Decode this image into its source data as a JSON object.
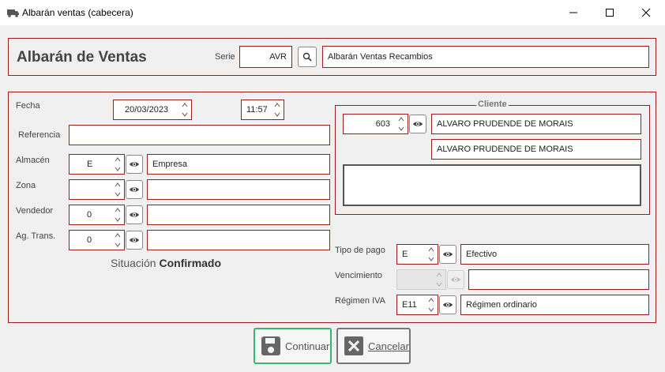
{
  "window": {
    "title": "Albarán ventas (cabecera)"
  },
  "header": {
    "title": "Albarán de Ventas",
    "serie_label": "Serie",
    "serie_value": "AVR",
    "serie_description": "Albarán Ventas Recambios"
  },
  "form": {
    "fecha_label": "Fecha",
    "fecha_value": "20/03/2023",
    "hora_value": "11:57",
    "referencia_label": "Referencia",
    "referencia_value": "",
    "almacen_label": "Almacén",
    "almacen_code": "E",
    "almacen_name": "Empresa",
    "zona_label": "Zona",
    "zona_code": "",
    "zona_name": "",
    "vendedor_label": "Vendedor",
    "vendedor_code": "0",
    "vendedor_name": "",
    "agtrans_label": "Ag. Trans.",
    "agtrans_code": "0",
    "agtrans_name": "",
    "situacion_label": "Situación",
    "situacion_value": "Confirmado"
  },
  "cliente": {
    "legend": "Cliente",
    "code": "603",
    "name": "ALVARO PRUDENDE DE MORAIS",
    "name2": "ALVARO PRUDENDE DE MORAIS",
    "notes": ""
  },
  "pago": {
    "tipo_label": "Tipo de pago",
    "tipo_code": "E",
    "tipo_name": "Efectivo",
    "vencimiento_label": "Vencimiento",
    "vencimiento_value": "",
    "vencimiento_name": "",
    "regimen_label": "Régimen IVA",
    "regimen_code": "E11",
    "regimen_name": "Régimen ordinario"
  },
  "buttons": {
    "continuar": "Continuar",
    "cancelar": "Cancelar"
  },
  "colors": {
    "field_border": "#9b1c1c",
    "continuar_border": "#3cb371",
    "background": "#f0f0f0"
  }
}
